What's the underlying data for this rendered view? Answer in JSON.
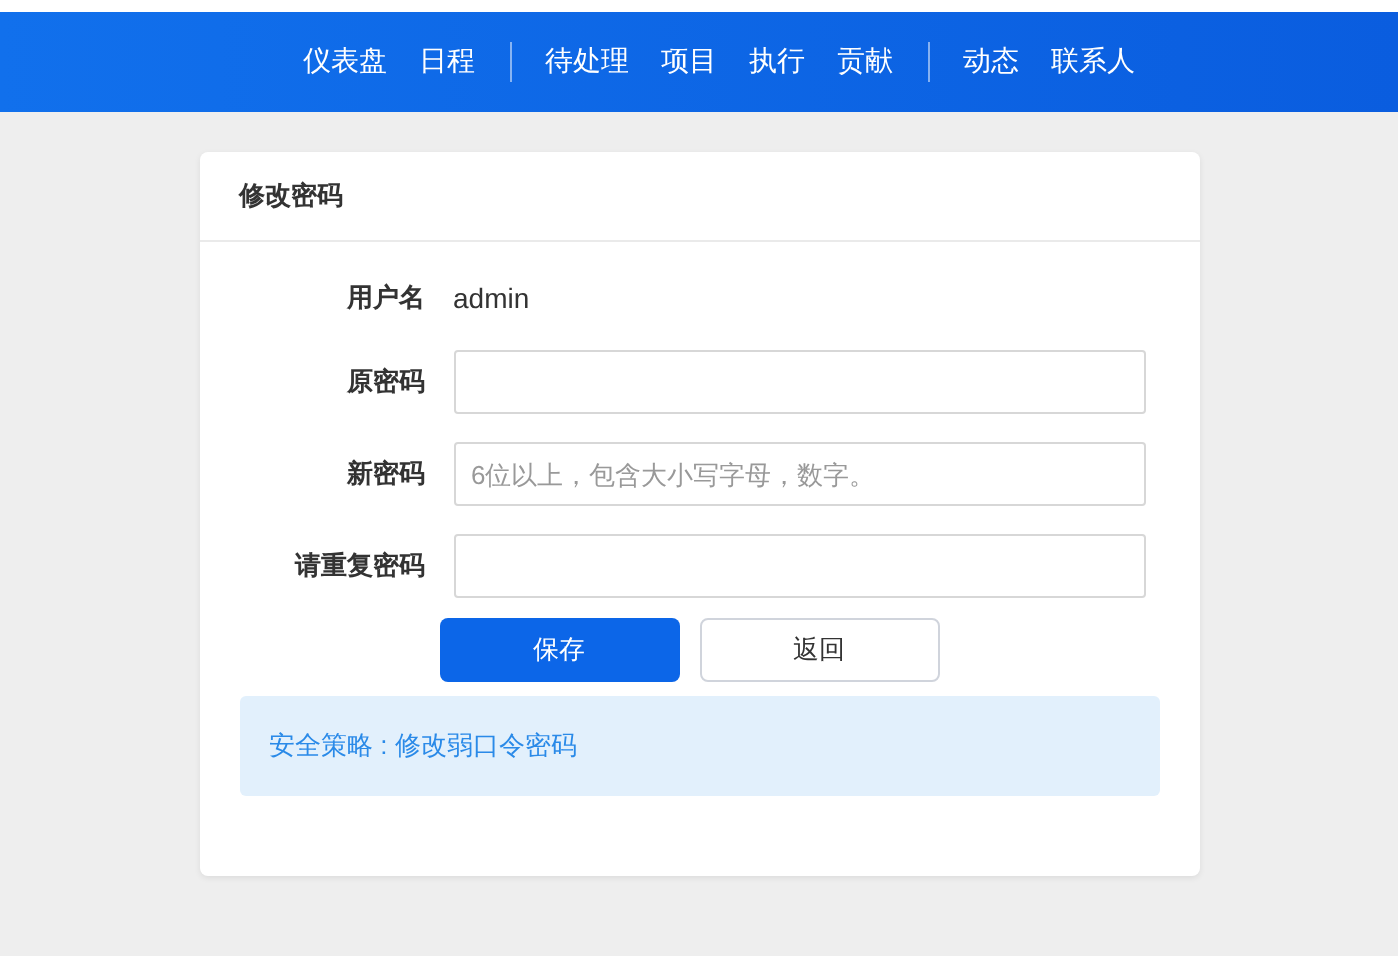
{
  "nav": {
    "groups": [
      [
        "仪表盘",
        "日程"
      ],
      [
        "待处理",
        "项目",
        "执行",
        "贡献"
      ],
      [
        "动态",
        "联系人"
      ]
    ]
  },
  "card": {
    "title": "修改密码",
    "fields": [
      {
        "kind": "text",
        "label": "用户名",
        "value": "admin"
      },
      {
        "kind": "input",
        "label": "原密码"
      },
      {
        "kind": "input",
        "label": "新密码",
        "placeholder": "6位以上，包含大小写字母，数字。"
      },
      {
        "kind": "input",
        "label": "请重复密码"
      }
    ],
    "buttons": [
      {
        "kind": "primary",
        "label": "保存"
      },
      {
        "kind": "default",
        "label": "返回"
      }
    ],
    "notice": "安全策略 : 修改弱口令密码"
  }
}
